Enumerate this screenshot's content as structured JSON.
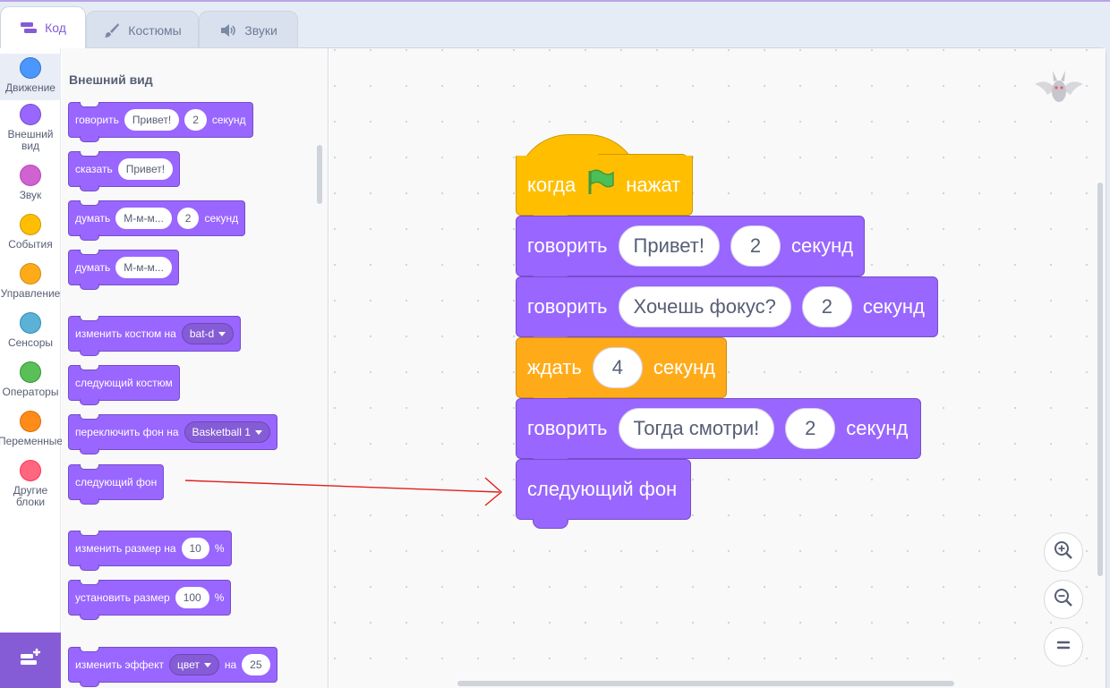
{
  "tabs": [
    {
      "label": "Код",
      "icon": "code-icon",
      "active": true
    },
    {
      "label": "Костюмы",
      "icon": "brush-icon",
      "active": false
    },
    {
      "label": "Звуки",
      "icon": "speaker-icon",
      "active": false
    }
  ],
  "categories": [
    {
      "label": "Движение",
      "color": "#4c97ff"
    },
    {
      "label": "Внешний вид",
      "color": "#9966ff"
    },
    {
      "label": "Звук",
      "color": "#cf63cf"
    },
    {
      "label": "События",
      "color": "#ffbf00"
    },
    {
      "label": "Управление",
      "color": "#ffab19"
    },
    {
      "label": "Сенсоры",
      "color": "#5cb1d6"
    },
    {
      "label": "Операторы",
      "color": "#59c059"
    },
    {
      "label": "Переменные",
      "color": "#ff8c1a"
    },
    {
      "label": "Другие блоки",
      "color": "#ff6680"
    }
  ],
  "extension_button": {
    "icon": "add-extension-icon"
  },
  "palette": {
    "title": "Внешний вид",
    "blocks": {
      "say_for": {
        "label": "говорить",
        "text": "Привет!",
        "secs": "2",
        "unit": "секунд"
      },
      "say": {
        "label": "сказать",
        "text": "Привет!"
      },
      "think_for": {
        "label": "думать",
        "text": "М-м-м...",
        "secs": "2",
        "unit": "секунд"
      },
      "think": {
        "label": "думать",
        "text": "М-м-м..."
      },
      "switch_costume": {
        "label": "изменить костюм на",
        "value": "bat-d"
      },
      "next_costume": {
        "label": "следующий костюм"
      },
      "switch_backdrop": {
        "label": "переключить фон на",
        "value": "Basketball 1"
      },
      "next_backdrop": {
        "label": "следующий фон"
      },
      "change_size": {
        "label": "изменить размер на",
        "value": "10",
        "unit": "%"
      },
      "set_size": {
        "label": "установить размер",
        "value": "100",
        "unit": "%"
      },
      "change_effect": {
        "label": "изменить эффект",
        "effect": "цвет",
        "mid": "на",
        "value": "25"
      }
    }
  },
  "script": {
    "hat": {
      "pre": "когда",
      "post": "нажат",
      "icon": "green-flag-icon"
    },
    "say1": {
      "label": "говорить",
      "text": "Привет!",
      "secs": "2",
      "unit": "секунд"
    },
    "say2": {
      "label": "говорить",
      "text": "Хочешь фокус?",
      "secs": "2",
      "unit": "секунд"
    },
    "wait": {
      "label": "ждать",
      "secs": "4",
      "unit": "секунд"
    },
    "say3": {
      "label": "говорить",
      "text": "Тогда смотри!",
      "secs": "2",
      "unit": "секунд"
    },
    "next_backdrop": {
      "label": "следующий фон"
    }
  },
  "sprite": {
    "icon": "bat-sprite-icon"
  },
  "zoom": {
    "zoom_in_icon": "zoom-in-icon",
    "zoom_out_icon": "zoom-out-icon",
    "reset_icon": "zoom-reset-icon"
  },
  "annotation": {
    "icon": "red-arrow-annotation",
    "color": "#e0201e"
  },
  "colors": {
    "looks": "#9966ff",
    "events": "#ffbf00",
    "control": "#ffab19",
    "accent": "#855cd6"
  }
}
